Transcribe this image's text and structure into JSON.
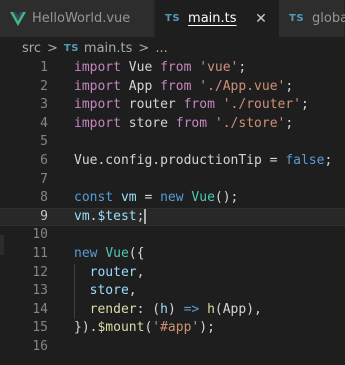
{
  "tabs": [
    {
      "label": "HelloWorld.vue",
      "icon": "vue-icon",
      "active": false
    },
    {
      "label": "main.ts",
      "icon_text": "TS",
      "active": true
    },
    {
      "label": "global.",
      "icon_text": "TS",
      "active": false
    }
  ],
  "breadcrumb": {
    "folder": "src",
    "separator": ">",
    "file_icon": "TS",
    "file": "main.ts",
    "trailing": "..."
  },
  "editor": {
    "current_line": 9,
    "lines": [
      {
        "n": "1",
        "tokens": [
          [
            "kw",
            "import"
          ],
          [
            "id",
            " Vue "
          ],
          [
            "kw",
            "from"
          ],
          [
            "id",
            " "
          ],
          [
            "str",
            "'vue'"
          ],
          [
            "id",
            ";"
          ]
        ]
      },
      {
        "n": "2",
        "tokens": [
          [
            "kw",
            "import"
          ],
          [
            "id",
            " App "
          ],
          [
            "kw",
            "from"
          ],
          [
            "id",
            " "
          ],
          [
            "str",
            "'./App.vue'"
          ],
          [
            "id",
            ";"
          ]
        ]
      },
      {
        "n": "3",
        "tokens": [
          [
            "kw",
            "import"
          ],
          [
            "id",
            " router "
          ],
          [
            "kw",
            "from"
          ],
          [
            "id",
            " "
          ],
          [
            "str",
            "'./router'"
          ],
          [
            "id",
            ";"
          ]
        ]
      },
      {
        "n": "4",
        "tokens": [
          [
            "kw",
            "import"
          ],
          [
            "id",
            " store "
          ],
          [
            "kw",
            "from"
          ],
          [
            "id",
            " "
          ],
          [
            "str",
            "'./store'"
          ],
          [
            "id",
            ";"
          ]
        ]
      },
      {
        "n": "5",
        "tokens": []
      },
      {
        "n": "6",
        "tokens": [
          [
            "id",
            "Vue.config.productionTip = "
          ],
          [
            "kw2",
            "false"
          ],
          [
            "id",
            ";"
          ]
        ]
      },
      {
        "n": "7",
        "tokens": []
      },
      {
        "n": "8",
        "tokens": [
          [
            "kw2",
            "const"
          ],
          [
            "id",
            " "
          ],
          [
            "var",
            "vm"
          ],
          [
            "id",
            " = "
          ],
          [
            "kw2",
            "new"
          ],
          [
            "id",
            " "
          ],
          [
            "cls",
            "Vue"
          ],
          [
            "id",
            "();"
          ]
        ]
      },
      {
        "n": "9",
        "tokens": [
          [
            "var",
            "vm"
          ],
          [
            "id",
            "."
          ],
          [
            "var",
            "$test"
          ],
          [
            "id",
            ";"
          ]
        ]
      },
      {
        "n": "10",
        "tokens": []
      },
      {
        "n": "11",
        "tokens": [
          [
            "kw2",
            "new"
          ],
          [
            "id",
            " "
          ],
          [
            "cls",
            "Vue"
          ],
          [
            "id",
            "({"
          ]
        ]
      },
      {
        "n": "12",
        "tokens": [
          [
            "id",
            "  "
          ],
          [
            "var",
            "router"
          ],
          [
            "id",
            ","
          ]
        ]
      },
      {
        "n": "13",
        "tokens": [
          [
            "id",
            "  "
          ],
          [
            "var",
            "store"
          ],
          [
            "id",
            ","
          ]
        ]
      },
      {
        "n": "14",
        "tokens": [
          [
            "id",
            "  "
          ],
          [
            "fn",
            "render"
          ],
          [
            "id",
            ": ("
          ],
          [
            "var",
            "h"
          ],
          [
            "id",
            ") "
          ],
          [
            "kw2",
            "=>"
          ],
          [
            "id",
            " "
          ],
          [
            "fn",
            "h"
          ],
          [
            "id",
            "(App),"
          ]
        ]
      },
      {
        "n": "15",
        "tokens": [
          [
            "id",
            "})."
          ],
          [
            "fn",
            "$mount"
          ],
          [
            "id",
            "("
          ],
          [
            "str",
            "'#app'"
          ],
          [
            "id",
            ");"
          ]
        ]
      },
      {
        "n": "16",
        "tokens": []
      }
    ]
  },
  "colors": {
    "background": "#1e1e1e",
    "keyword_purple": "#c586c0",
    "keyword_blue": "#569cd6",
    "string": "#ce9178",
    "variable": "#9cdcfe",
    "function": "#dcdcaa",
    "class": "#4ec9b0",
    "ts_icon": "#519aba",
    "vue_icon": "#41b883"
  }
}
